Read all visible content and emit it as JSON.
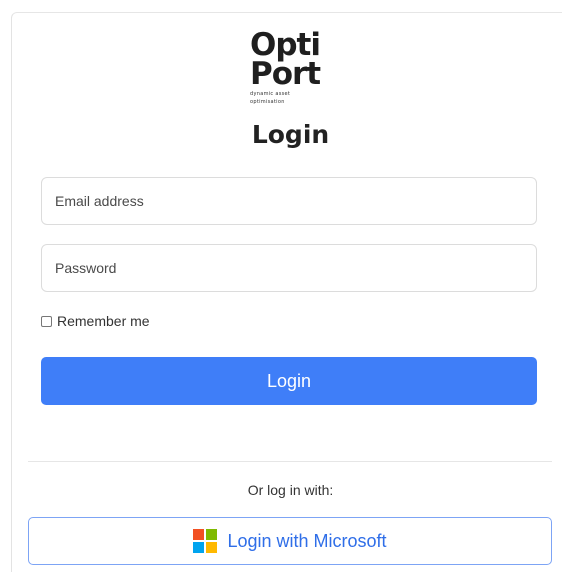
{
  "logo": {
    "line1": "Opti",
    "line2": "Port",
    "tagline1": "dynamic asset",
    "tagline2": "optimisation"
  },
  "heading": "Login",
  "form": {
    "email_placeholder": "Email address",
    "email_value": "",
    "password_placeholder": "Password",
    "password_value": "",
    "remember_label": "Remember me",
    "remember_checked": false,
    "login_label": "Login"
  },
  "alt_login": {
    "or_text": "Or log in with:",
    "microsoft_label": "Login with Microsoft",
    "microsoft_icon": "microsoft-logo-icon"
  },
  "colors": {
    "primary": "#3f7ef8",
    "ms_red": "#f25022",
    "ms_green": "#7fba00",
    "ms_blue": "#00a4ef",
    "ms_yellow": "#ffb900"
  }
}
